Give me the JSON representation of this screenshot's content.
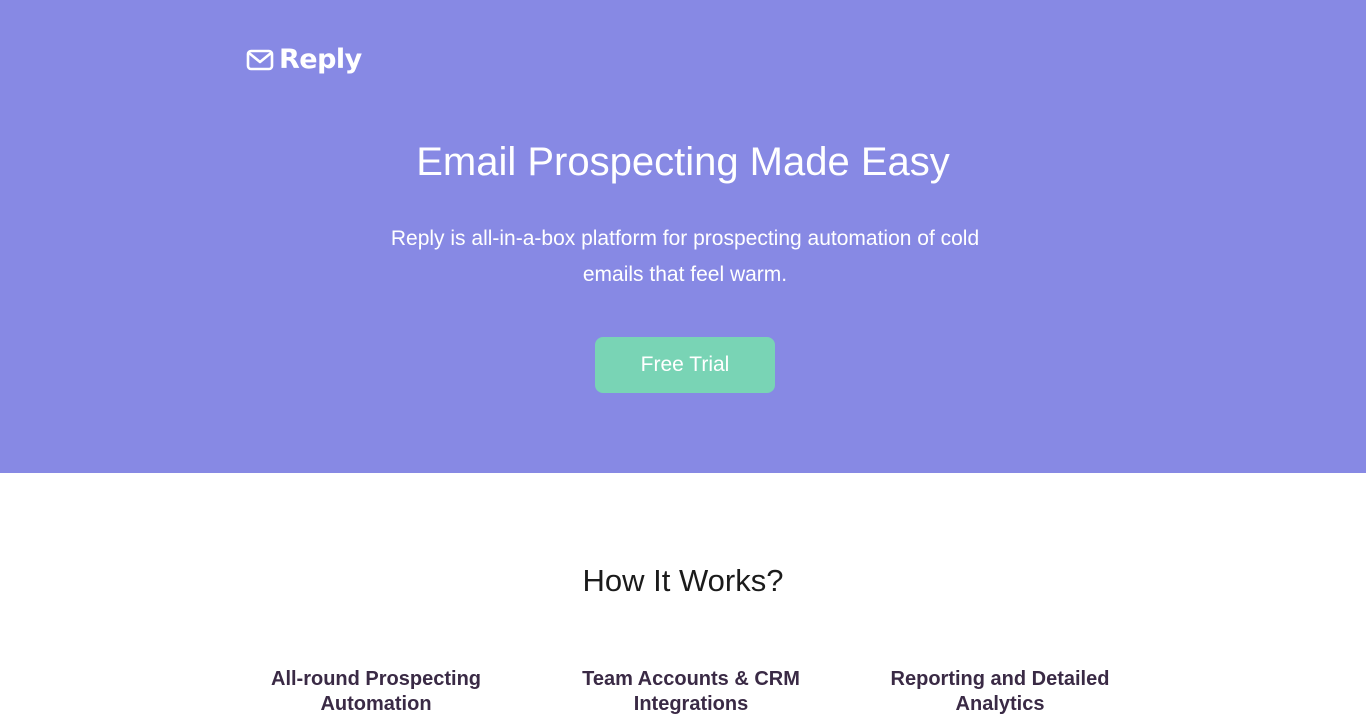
{
  "colors": {
    "hero_background": "#8789e4",
    "cta_background": "#79d4b5",
    "feature_text": "#3a2a45"
  },
  "header": {
    "logo_icon": "envelope-icon",
    "logo_text": "Reply"
  },
  "hero": {
    "title": "Email Prospecting Made Easy",
    "subtitle": "Reply is all-in-a-box platform for prospecting automation of cold emails that feel warm.",
    "cta_label": "Free Trial"
  },
  "how_it_works": {
    "title": "How It Works?",
    "features": [
      {
        "title": "All-round Prospecting Automation"
      },
      {
        "title": "Team Accounts & CRM Integrations"
      },
      {
        "title": "Reporting and Detailed Analytics"
      }
    ]
  }
}
